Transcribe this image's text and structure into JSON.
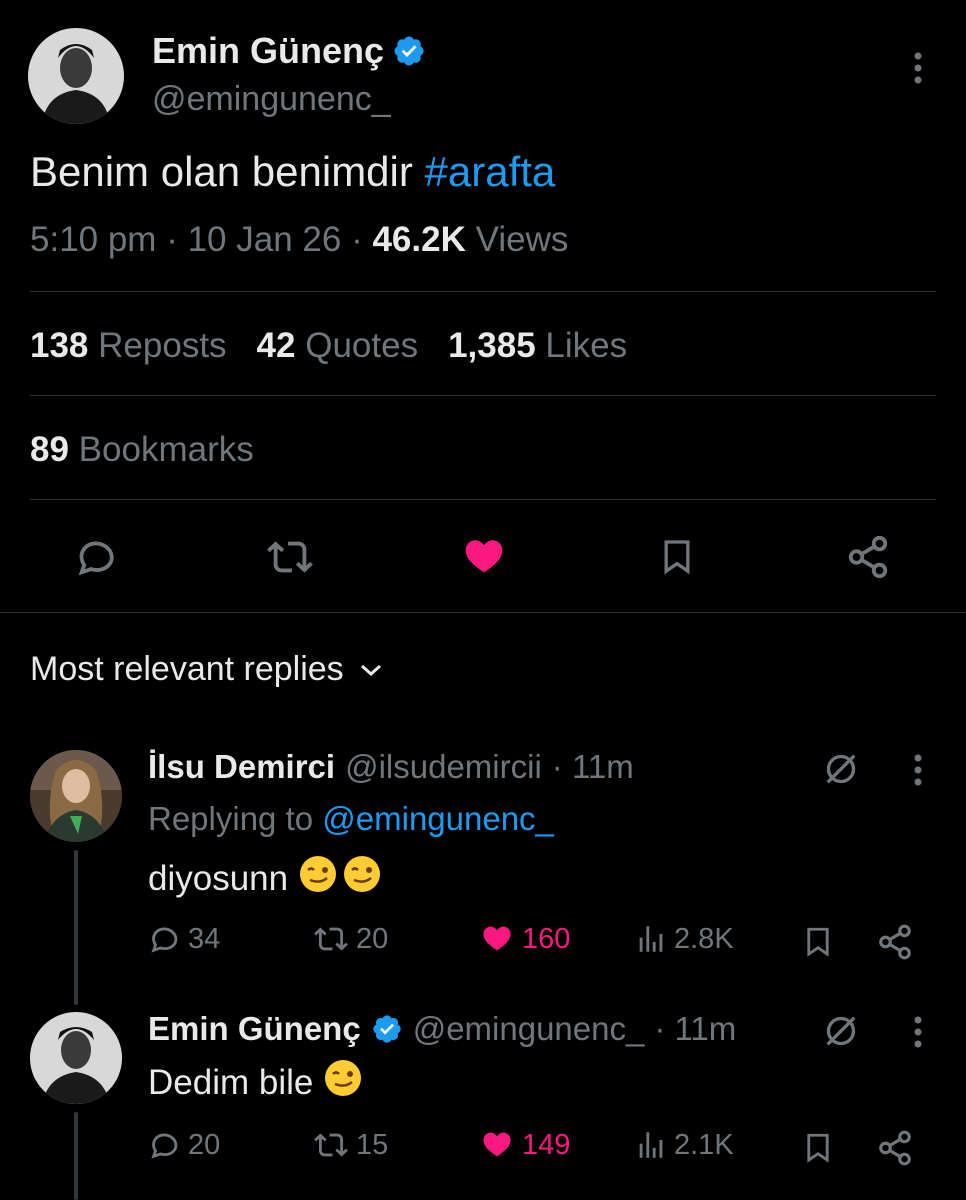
{
  "main_tweet": {
    "author_name": "Emin Günenç",
    "author_handle": "@emingunenc_",
    "text": "Benim olan benimdir ",
    "hashtag": "#arafta",
    "time": "5:10 pm",
    "date": "10 Jan 26",
    "views_count": "46.2K",
    "views_label": "Views",
    "reposts_count": "138",
    "reposts_label": "Reposts",
    "quotes_count": "42",
    "quotes_label": "Quotes",
    "likes_count": "1,385",
    "likes_label": "Likes",
    "bookmarks_count": "89",
    "bookmarks_label": "Bookmarks"
  },
  "replies_header": "Most relevant replies",
  "replies": [
    {
      "name": "İlsu Demirci",
      "handle": "@ilsudemircii",
      "time": "· 11m",
      "replying_label": "Replying to ",
      "replying_handle": "@emingunenc_",
      "text": "diyosunn",
      "replies": "34",
      "reposts": "20",
      "likes": "160",
      "views": "2.8K"
    },
    {
      "name": "Emin Günenç",
      "handle": "@emingunenc_",
      "time": "· 11m",
      "text": "Dedim bile",
      "replies": "20",
      "reposts": "15",
      "likes": "149",
      "views": "2.1K"
    }
  ],
  "colors": {
    "background": "#000000",
    "text": "#e7e9ea",
    "muted": "#71767b",
    "accent_blue": "#1d9bf0",
    "like_pink": "#f91880",
    "divider": "#2f3336"
  }
}
